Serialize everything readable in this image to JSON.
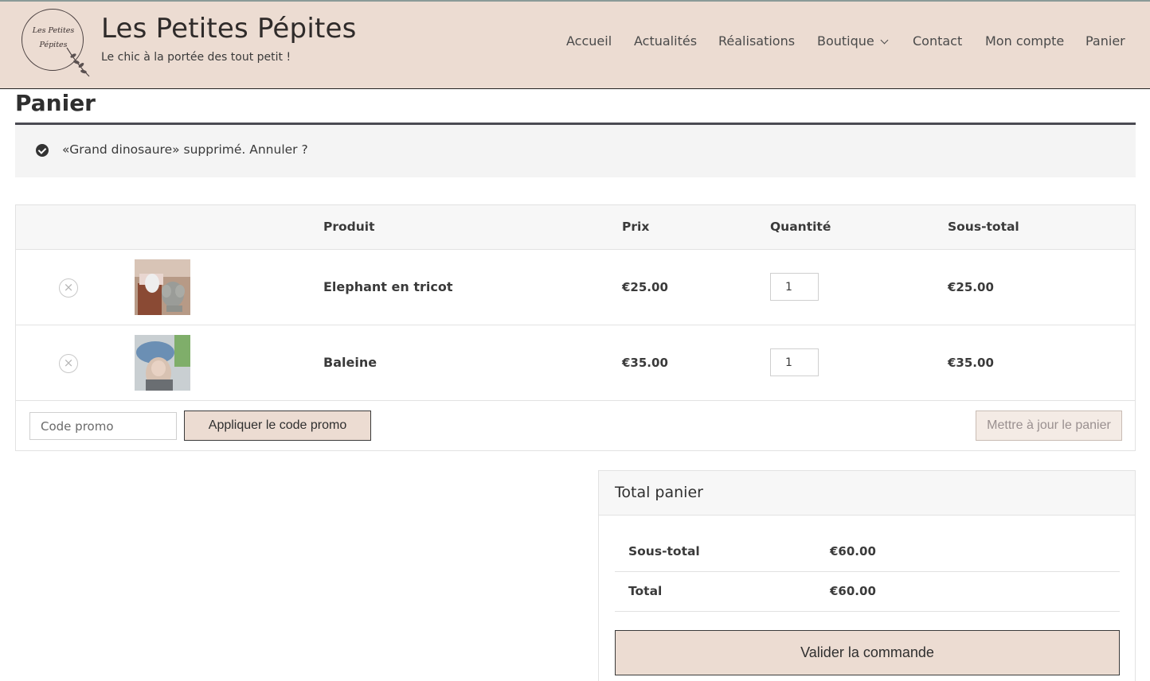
{
  "site": {
    "logo_text_line1": "Les Petites",
    "logo_text_line2": "Pépites",
    "title": "Les Petites Pépites",
    "tagline": "Le chic à la portée des tout petit !"
  },
  "nav": {
    "items": [
      {
        "label": "Accueil"
      },
      {
        "label": "Actualités"
      },
      {
        "label": "Réalisations"
      },
      {
        "label": "Boutique",
        "has_dropdown": true
      },
      {
        "label": "Contact"
      },
      {
        "label": "Mon compte"
      },
      {
        "label": "Panier"
      }
    ]
  },
  "page": {
    "title": "Panier"
  },
  "notice": {
    "icon": "check-circle-icon",
    "text": "«Grand dinosaure» supprimé. Annuler ?"
  },
  "cart": {
    "headers": {
      "product": "Produit",
      "price": "Prix",
      "quantity": "Quantité",
      "subtotal": "Sous-total"
    },
    "items": [
      {
        "name": "Elephant en tricot",
        "price": "€25.00",
        "quantity": "1",
        "subtotal": "€25.00",
        "remove_icon": "×"
      },
      {
        "name": "Baleine",
        "price": "€35.00",
        "quantity": "1",
        "subtotal": "€35.00",
        "remove_icon": "×"
      }
    ],
    "coupon_placeholder": "Code promo",
    "apply_label": "Appliquer le code promo",
    "update_label": "Mettre à jour le panier"
  },
  "totals": {
    "title": "Total panier",
    "subtotal_label": "Sous-total",
    "subtotal_value": "€60.00",
    "total_label": "Total",
    "total_value": "€60.00",
    "checkout_label": "Valider la commande"
  },
  "colors": {
    "header_bg": "#ecdcd2",
    "button_bg": "#ecdcd2",
    "text": "#3a3a3a"
  }
}
